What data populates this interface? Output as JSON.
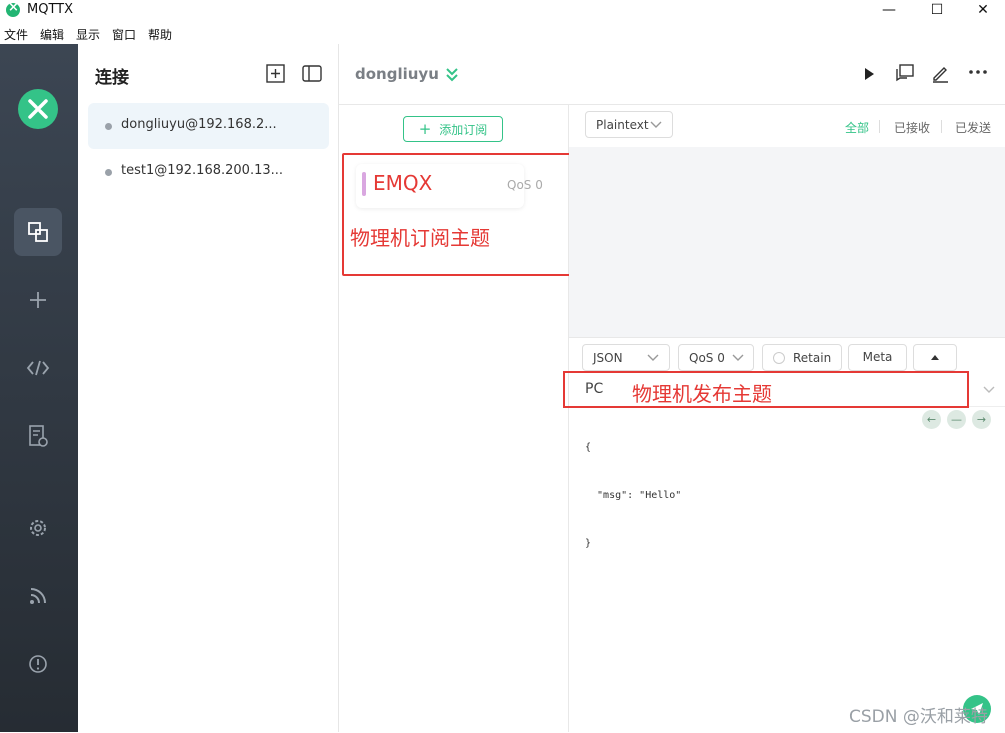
{
  "window": {
    "title": "MQTTX",
    "minimize": "—",
    "maximize": "☐",
    "close": "✕"
  },
  "menu": [
    "文件",
    "编辑",
    "显示",
    "窗口",
    "帮助"
  ],
  "connections": {
    "title": "连接",
    "items": [
      {
        "label": "dongliuyu@192.168.2...",
        "active": true
      },
      {
        "label": "test1@192.168.200.13...",
        "active": false
      }
    ]
  },
  "header": {
    "name": "dongliuyu"
  },
  "subscriptions": {
    "add_label": "添加订阅",
    "items": [
      {
        "topic": "EMQX",
        "qos": "QoS 0",
        "color": "#d9a7e0"
      }
    ]
  },
  "messages": {
    "format": "Plaintext",
    "filters": [
      "全部",
      "已接收",
      "已发送"
    ]
  },
  "publish": {
    "payload_type": "JSON",
    "qos": "QoS 0",
    "retain": "Retain",
    "meta": "Meta",
    "topic": "PC",
    "payload_lines": [
      "{",
      "  \"msg\": \"Hello\"",
      "}"
    ]
  },
  "annotations": {
    "subscribe": "物理机订阅主题",
    "publish": "物理机发布主题"
  },
  "watermark": "CSDN @沃和莱特",
  "colors": {
    "accent": "#34c388",
    "annotation": "#e53935",
    "rail": "#2d343c"
  }
}
